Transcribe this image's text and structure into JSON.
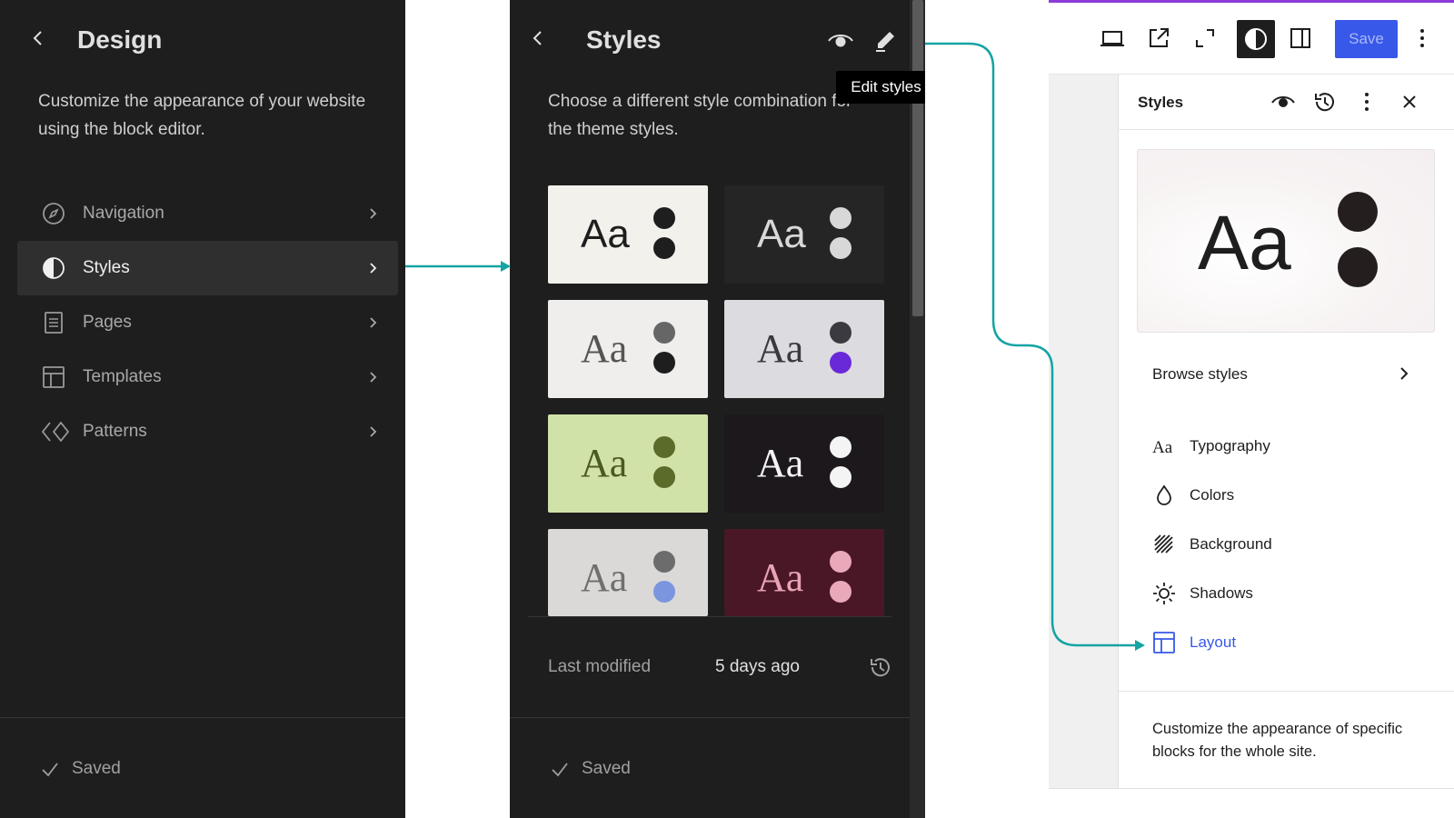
{
  "design_panel": {
    "title": "Design",
    "description": "Customize the appearance of your website using the block editor.",
    "nav_items": [
      {
        "label": "Navigation",
        "icon": "navigation-icon"
      },
      {
        "label": "Styles",
        "icon": "styles-icon",
        "active": true
      },
      {
        "label": "Pages",
        "icon": "pages-icon"
      },
      {
        "label": "Templates",
        "icon": "templates-icon"
      },
      {
        "label": "Patterns",
        "icon": "patterns-icon"
      }
    ],
    "footer_status": "Saved"
  },
  "styles_panel": {
    "title": "Styles",
    "description": "Choose a different style combination for the theme styles.",
    "tooltip": "Edit styles",
    "style_variations": [
      {
        "sample": "Aa",
        "bg": "#f2f1ec",
        "text": "#1e1e1e",
        "dot1": "#1e1e1e",
        "dot2": "#1e1e1e"
      },
      {
        "sample": "Aa",
        "bg": "#252525",
        "text": "#d8d8d8",
        "dot1": "#d8d8d8",
        "dot2": "#d8d8d8"
      },
      {
        "sample": "Aa",
        "bg": "#efeeec",
        "text": "#555555",
        "dot1": "#666666",
        "dot2": "#1e1e1e"
      },
      {
        "sample": "Aa",
        "bg": "#dcdce0",
        "text": "#3a3a3e",
        "dot1": "#3a3a40",
        "dot2": "#6a29d9"
      },
      {
        "sample": "Aa",
        "bg": "#d1e2a8",
        "text": "#4a5a23",
        "dot1": "#5a6b2a",
        "dot2": "#5a6b2a"
      },
      {
        "sample": "Aa",
        "bg": "#1c181c",
        "text": "#f4f4f4",
        "dot1": "#f4f4f4",
        "dot2": "#f4f4f4"
      },
      {
        "sample": "Aa",
        "bg": "#dad9d8",
        "text": "#707070",
        "dot1": "#6c6c6c",
        "dot2": "#7b95de"
      },
      {
        "sample": "Aa",
        "bg": "#4a1726",
        "text": "#e7a3b4",
        "dot1": "#e9a9ba",
        "dot2": "#e9a9ba"
      }
    ],
    "last_modified_label": "Last modified",
    "last_modified_value": "5 days ago",
    "footer_status": "Saved"
  },
  "editor": {
    "toolbar": {
      "icons": [
        "device-preview-icon",
        "external-view-icon",
        "fullscreen-icon",
        "styles-contrast-icon",
        "sidebar-toggle-icon",
        "more-vertical-icon"
      ],
      "save_label": "Save"
    },
    "sidebar": {
      "title": "Styles",
      "preview_sample": "Aa",
      "browse_label": "Browse styles",
      "menu": [
        {
          "label": "Typography",
          "icon": "typography-icon"
        },
        {
          "label": "Colors",
          "icon": "droplet-icon"
        },
        {
          "label": "Background",
          "icon": "background-icon"
        },
        {
          "label": "Shadows",
          "icon": "shadow-icon"
        },
        {
          "label": "Layout",
          "icon": "layout-icon",
          "highlighted": true
        }
      ],
      "footer_text": "Customize the appearance of specific blocks for the whole site."
    }
  },
  "colors": {
    "panel_bg": "#1e1e1e",
    "accent_teal": "#15a3a3",
    "admin_blue": "#3858e9",
    "topbar_purple": "#8c3bd9"
  }
}
